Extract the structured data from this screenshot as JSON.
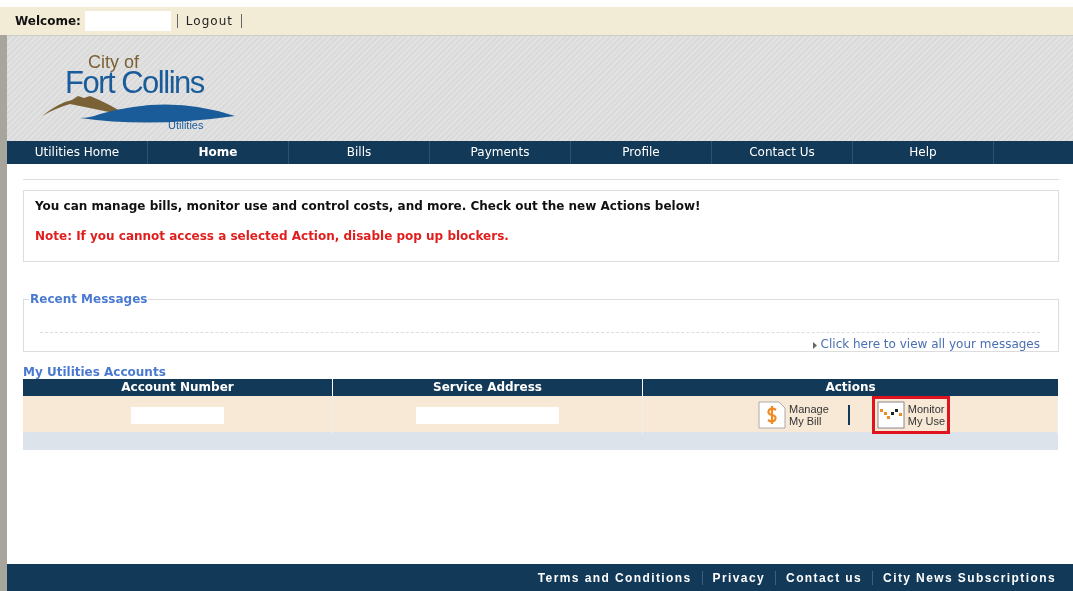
{
  "top_bar": {
    "welcome_label": "Welcome:",
    "logout": "Logout"
  },
  "logo": {
    "line_1": "City of",
    "line_2": "Fort Collins",
    "line_3": "Utilities"
  },
  "nav": [
    {
      "label": "Utilities Home",
      "selected": false
    },
    {
      "label": "Home",
      "selected": true
    },
    {
      "label": "Bills",
      "selected": false
    },
    {
      "label": "Payments",
      "selected": false
    },
    {
      "label": "Profile",
      "selected": false
    },
    {
      "label": "Contact Us",
      "selected": false
    },
    {
      "label": "Help",
      "selected": false
    }
  ],
  "notice": {
    "message": "You can manage bills, monitor use and control costs, and more. Check out the new Actions below!",
    "note": "Note: If you cannot access a selected Action, disable pop up blockers."
  },
  "recent_messages": {
    "title": "Recent Messages",
    "link": "Click here to view all your messages"
  },
  "accounts": {
    "title": "My Utilities Accounts",
    "columns": [
      "Account Number",
      "Service Address",
      "Actions"
    ],
    "actions": [
      {
        "kind": "bill",
        "line_1": "Manage",
        "line_2": "My Bill",
        "highlighted": false
      },
      {
        "kind": "usage",
        "line_1": "Monitor",
        "line_2": "My Use",
        "highlighted": true
      }
    ]
  },
  "footer": [
    "Terms and Conditions",
    "Privacy",
    "Contact us",
    "City News Subscriptions"
  ]
}
